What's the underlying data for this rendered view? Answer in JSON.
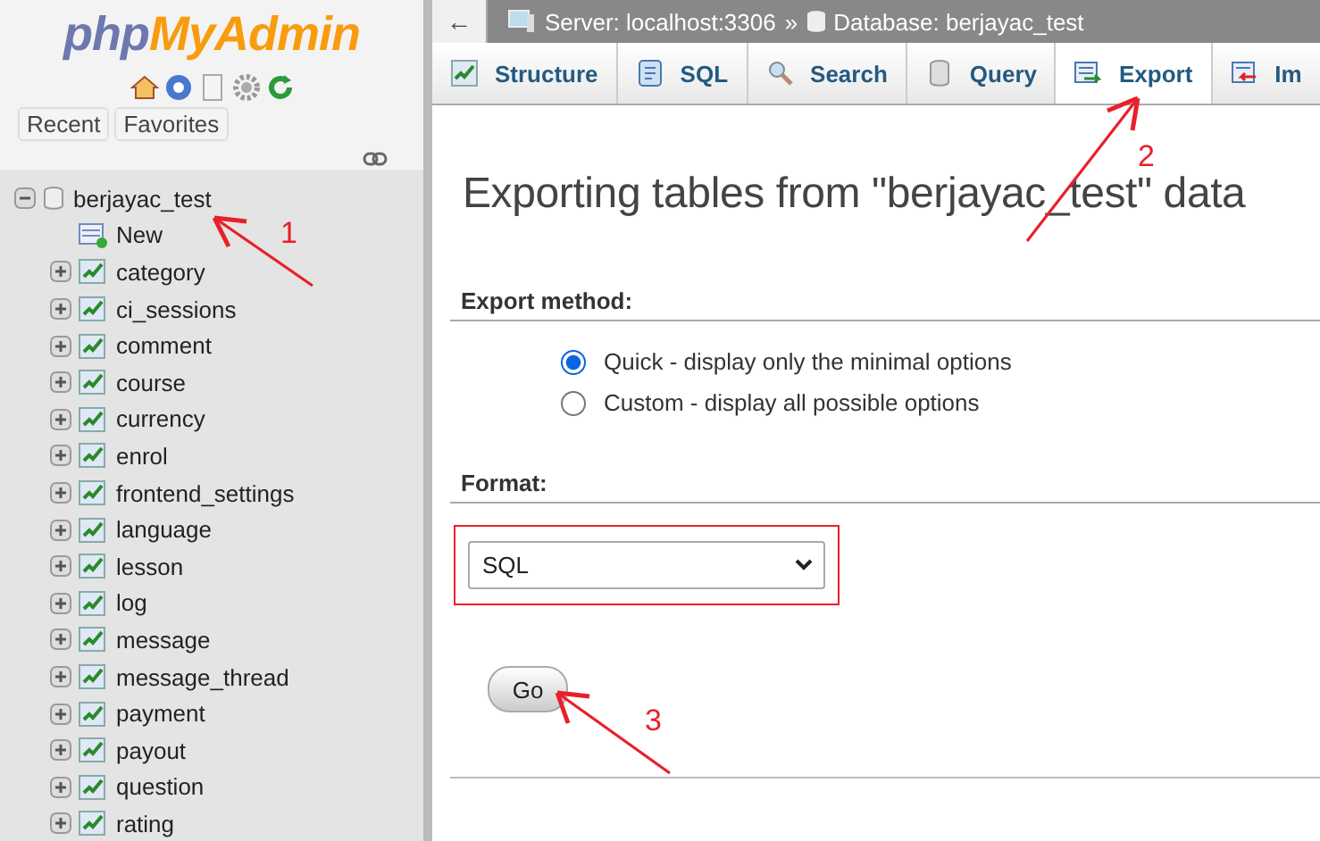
{
  "sidebar": {
    "logo": {
      "php": "php",
      "myadmin": "MyAdmin"
    },
    "buttons": [
      "Recent",
      "Favorites"
    ],
    "tree": [
      {
        "label": "berjayac_test",
        "expanded": true,
        "children": [
          {
            "label": "New",
            "kind": "new"
          },
          {
            "label": "category",
            "kind": "table"
          },
          {
            "label": "ci_sessions",
            "kind": "table"
          },
          {
            "label": "comment",
            "kind": "table"
          },
          {
            "label": "course",
            "kind": "table"
          },
          {
            "label": "currency",
            "kind": "table"
          },
          {
            "label": "enrol",
            "kind": "table"
          },
          {
            "label": "frontend_settings",
            "kind": "table"
          },
          {
            "label": "language",
            "kind": "table"
          },
          {
            "label": "lesson",
            "kind": "table"
          },
          {
            "label": "log",
            "kind": "table"
          },
          {
            "label": "message",
            "kind": "table"
          },
          {
            "label": "message_thread",
            "kind": "table"
          },
          {
            "label": "payment",
            "kind": "table"
          },
          {
            "label": "payout",
            "kind": "table"
          },
          {
            "label": "question",
            "kind": "table"
          },
          {
            "label": "rating",
            "kind": "table"
          }
        ]
      }
    ]
  },
  "breadcrumb": {
    "back": "←",
    "server": "Server: localhost:3306",
    "separator": "»",
    "database": "Database: berjayac_test"
  },
  "tabs": [
    {
      "label": "Structure",
      "kind": "structure",
      "selected": false
    },
    {
      "label": "SQL",
      "kind": "sql",
      "selected": false
    },
    {
      "label": "Search",
      "kind": "search",
      "selected": false
    },
    {
      "label": "Query",
      "kind": "query",
      "selected": false
    },
    {
      "label": "Export",
      "kind": "export",
      "selected": true
    },
    {
      "label": "Im",
      "kind": "import",
      "selected": false
    }
  ],
  "page_title": "Exporting tables from \"berjayac_test\" data",
  "export_method": {
    "heading": "Export method:",
    "options": [
      {
        "label": "Quick - display only the minimal options",
        "selected": true
      },
      {
        "label": "Custom - display all possible options",
        "selected": false
      }
    ]
  },
  "format": {
    "heading": "Format:",
    "value": "SQL"
  },
  "go_button": "Go",
  "annotations": [
    {
      "label": "1"
    },
    {
      "label": "2"
    },
    {
      "label": "3"
    }
  ]
}
